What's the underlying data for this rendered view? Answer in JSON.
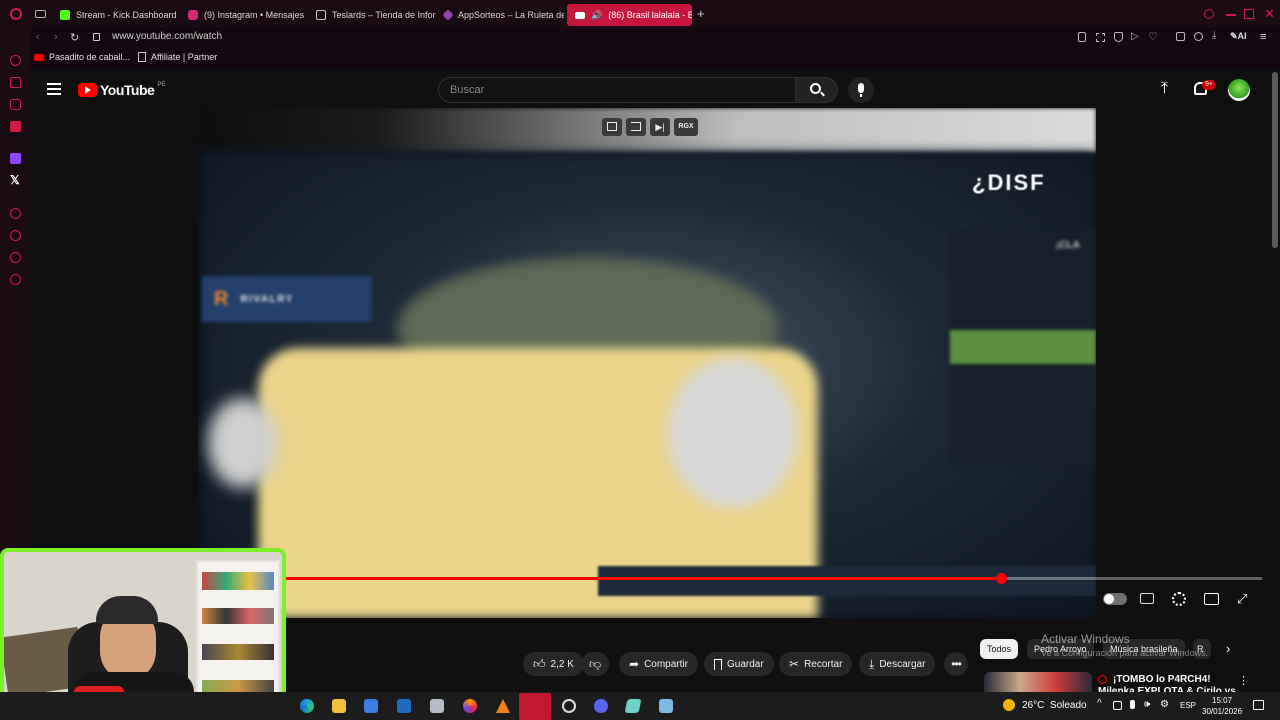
{
  "browser": {
    "tabs": [
      {
        "title": "Stream - Kick Dashboard",
        "color": "#53fc18"
      },
      {
        "title": "(9) Instagram • Mensajes",
        "color": "#d62976"
      },
      {
        "title": "Teslards – Tienda de Infor",
        "color": "#cccccc"
      },
      {
        "title": "AppSorteos – La Ruleta de",
        "color": "#8e44ad"
      },
      {
        "title": "(86) Brasil lalalala - Bu",
        "color": "#ff0000",
        "active": true
      }
    ],
    "url": "www.youtube.com/watch",
    "bookmarks": [
      "Pasadito de caball...",
      "Affiliate | Partner"
    ],
    "ai_label": "AI"
  },
  "youtube": {
    "logo_text": "YouTube",
    "country_code": "PE",
    "search_placeholder": "Buscar",
    "notification_badge": "9+"
  },
  "video": {
    "overlay_label": "RGX",
    "brand_text": "RIVALRY",
    "headline_text": "¿DISF",
    "panel_text": "¡CLA",
    "progress": 0.733
  },
  "actions": {
    "likes": "2,2 K",
    "share": "Compartir",
    "save": "Guardar",
    "clip": "Recortar",
    "download": "Descargar"
  },
  "chips": [
    "Todos",
    "Pedro Arroyo",
    "Música brasileña",
    "R"
  ],
  "watermark": {
    "title": "Activar Windows",
    "subtitle": "Ve a Configuración para activar Windows."
  },
  "recommended": {
    "line1": "¡TOMBO lo P4RCH4!",
    "line2": "Milenka EXPLOTA & Cirilo vs"
  },
  "taskbar": {
    "weather": "26°C  Soleado",
    "language": "ESP",
    "time": "15:07",
    "date": "30/01/2026"
  }
}
